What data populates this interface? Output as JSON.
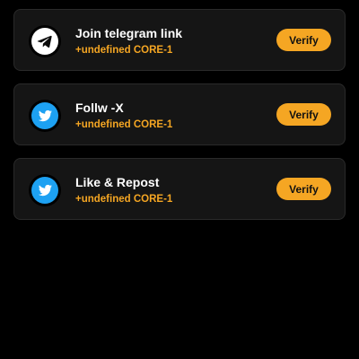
{
  "tasks": [
    {
      "title": "Join telegram link",
      "reward": "+undefined CORE-1",
      "button_label": "Verify",
      "icon": "telegram-icon"
    },
    {
      "title": "Follw -X",
      "reward": "+undefined CORE-1",
      "button_label": "Verify",
      "icon": "twitter-icon"
    },
    {
      "title": "Like & Repost",
      "reward": "+undefined CORE-1",
      "button_label": "Verify",
      "icon": "twitter-icon"
    }
  ],
  "colors": {
    "accent": "#f5a623",
    "card_bg": "#151515",
    "page_bg": "#000000",
    "twitter_blue": "#1da1f2"
  }
}
